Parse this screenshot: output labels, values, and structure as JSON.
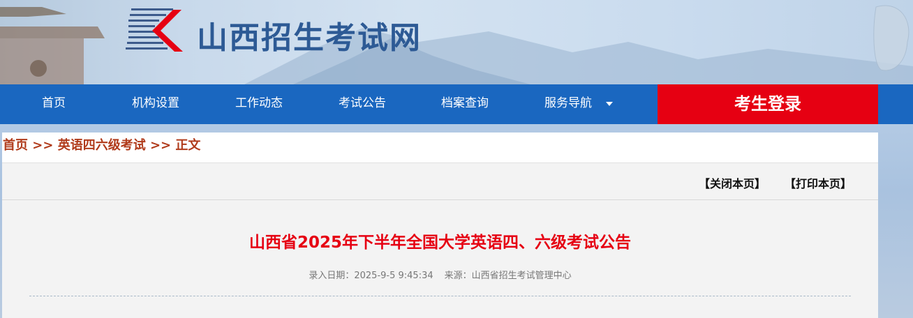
{
  "header": {
    "site_title": "山西招生考试网"
  },
  "nav": {
    "items": [
      {
        "label": "首页"
      },
      {
        "label": "机构设置"
      },
      {
        "label": "工作动态"
      },
      {
        "label": "考试公告"
      },
      {
        "label": "档案查询"
      },
      {
        "label": "服务导航"
      }
    ],
    "login_label": "考生登录"
  },
  "breadcrumb": {
    "home": "首页",
    "sep1": " >> ",
    "category": "英语四六级考试",
    "sep2": " >> ",
    "current": "正文"
  },
  "toolbar": {
    "close_label": "【关闭本页】",
    "print_label": "【打印本页】"
  },
  "article": {
    "title": "山西省2025年下半年全国大学英语四、六级考试公告",
    "date_text": "录入日期：2025-9-5 9:45:34",
    "source_text": "来源：山西省招生考试管理中心"
  },
  "colors": {
    "nav_bg": "#1a67c0",
    "login_bg": "#e60012",
    "title_red": "#e60012",
    "crumb": "#b03a1a"
  }
}
